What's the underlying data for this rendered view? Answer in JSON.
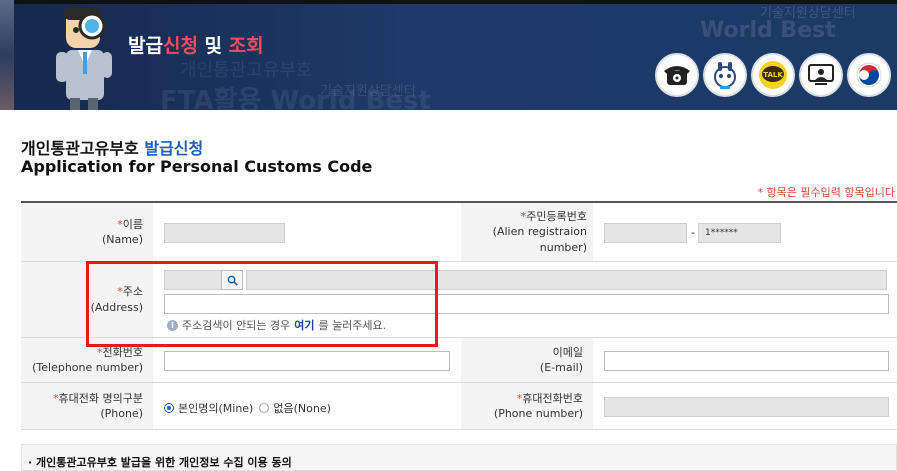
{
  "banner": {
    "title_part1": "발급",
    "title_part2": "신청",
    "title_part3": " 및 ",
    "title_part4": "조회",
    "watermark_1": "개인통관고유부호",
    "watermark_2": "FTA활용 World Best",
    "watermark_3": "World Best",
    "watermark_4": "기술지원상담센터",
    "quick_icons": [
      "phone-icon",
      "chatbot-icon",
      "talk-icon",
      "remote-support-icon",
      "korea-emblem-icon"
    ],
    "talk_label": "TALK"
  },
  "page": {
    "title_ko_main": "개인통관고유부호 ",
    "title_ko_accent": "발급신청",
    "title_en": "Application for Personal Customs Code",
    "required_note": "* 항목은 필수입력 항목입니다"
  },
  "form": {
    "name": {
      "label": "이름",
      "label_en": "(Name)"
    },
    "rrn": {
      "label": "주민등록번호",
      "label_en": "(Alien registraion number)",
      "second_value": "1******",
      "separator": "-"
    },
    "address": {
      "label": "주소",
      "label_en": "(Address)",
      "hint_before": "주소검색이 안되는 경우 ",
      "hint_link": "여기",
      "hint_after": "를 눌러주세요."
    },
    "telephone": {
      "label": "전화번호",
      "label_en": "(Telephone number)"
    },
    "email": {
      "label": "이메일",
      "label_en": "(E-mail)"
    },
    "phone_owner": {
      "label": "휴대전화 명의구분",
      "label_en": "(Phone)",
      "option_self": "본인명의(Mine)",
      "option_none": "없음(None)"
    },
    "mobile": {
      "label": "휴대전화번호",
      "label_en": "(Phone number)"
    }
  },
  "consent": {
    "heading": "· 개인통관고유부호 발급을 위한 개인정보 수집 이용 동의"
  },
  "colors": {
    "banner": "#1d3a68",
    "accent_red": "#ff4b5c",
    "required": "#e0443e",
    "highlight": "#e21b1b",
    "link": "#1c3fa8"
  }
}
